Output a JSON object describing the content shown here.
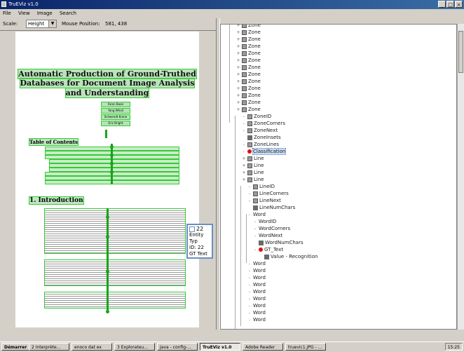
{
  "window": {
    "title": "TruEViz v1.0",
    "controls": [
      "_",
      "□",
      "×"
    ]
  },
  "menu": [
    "File",
    "View",
    "Image",
    "Search"
  ],
  "toolbar": {
    "scale_label": "Scale:",
    "scale_value": "Height",
    "mouse_label": "Mouse Position:",
    "mouse_value": "581, 438"
  },
  "document": {
    "title_lines": [
      "Automatic Production of Ground-Truthed",
      "Databases for Document Image Analysis",
      "and Understanding"
    ],
    "authors": [
      "Faron Bassi",
      "Yang Wholl",
      "Schwendt Krone",
      "Eric Bright"
    ],
    "toc_heading": "Table of Contents",
    "section_heading": "1. Introduction"
  },
  "tooltip": {
    "number": "22",
    "lines": [
      "Entity Typ",
      "ID: 22",
      "GT Text"
    ]
  },
  "tree": [
    {
      "label": "Zone",
      "icon": "doc",
      "depth": 0,
      "handle": "+"
    },
    {
      "label": "Zone",
      "icon": "doc",
      "depth": 0,
      "handle": "+"
    },
    {
      "label": "Zone",
      "icon": "doc",
      "depth": 0,
      "handle": "+"
    },
    {
      "label": "Zone",
      "icon": "doc",
      "depth": 0,
      "handle": "+"
    },
    {
      "label": "Zone",
      "icon": "doc",
      "depth": 0,
      "handle": "+"
    },
    {
      "label": "Zone",
      "icon": "doc",
      "depth": 0,
      "handle": "+"
    },
    {
      "label": "Zone",
      "icon": "doc",
      "depth": 0,
      "handle": "+"
    },
    {
      "label": "Zone",
      "icon": "doc",
      "depth": 0,
      "handle": "+"
    },
    {
      "label": "Zone",
      "icon": "doc",
      "depth": 0,
      "handle": "+"
    },
    {
      "label": "Zone",
      "icon": "doc",
      "depth": 0,
      "handle": "+"
    },
    {
      "label": "Zone",
      "icon": "doc",
      "depth": 0,
      "handle": "+"
    },
    {
      "label": "Zone",
      "icon": "doc",
      "depth": 0,
      "handle": "+"
    },
    {
      "label": "Zone",
      "icon": "doc",
      "depth": 0,
      "handle": "+"
    },
    {
      "label": "ZoneID",
      "icon": "doc",
      "depth": 1,
      "handle": "-"
    },
    {
      "label": "ZoneCorners",
      "icon": "doc",
      "depth": 1,
      "handle": "-"
    },
    {
      "label": "ZoneNext",
      "icon": "doc",
      "depth": 1,
      "handle": "-"
    },
    {
      "label": "ZoneInsets",
      "icon": "leaf",
      "depth": 1,
      "handle": ""
    },
    {
      "label": "ZoneLines",
      "icon": "doc",
      "depth": 1,
      "handle": "-"
    },
    {
      "label": "Classification",
      "icon": "err",
      "depth": 1,
      "handle": "-",
      "selected": true
    },
    {
      "label": "Line",
      "icon": "doc",
      "depth": 1,
      "handle": "+"
    },
    {
      "label": "Line",
      "icon": "doc",
      "depth": 1,
      "handle": "+"
    },
    {
      "label": "Line",
      "icon": "doc",
      "depth": 1,
      "handle": "+"
    },
    {
      "label": "Line",
      "icon": "doc",
      "depth": 1,
      "handle": "+"
    },
    {
      "label": "LineID",
      "icon": "doc",
      "depth": 2,
      "handle": "-"
    },
    {
      "label": "LineCorners",
      "icon": "doc",
      "depth": 2,
      "handle": "-"
    },
    {
      "label": "LineNext",
      "icon": "doc",
      "depth": 2,
      "handle": "-"
    },
    {
      "label": "LineNumChars",
      "icon": "leaf",
      "depth": 2,
      "handle": ""
    },
    {
      "label": "Word",
      "icon": "none",
      "depth": 2,
      "handle": "-"
    },
    {
      "label": "WordID",
      "icon": "none",
      "depth": 3,
      "handle": "-"
    },
    {
      "label": "WordCorners",
      "icon": "none",
      "depth": 3,
      "handle": "-"
    },
    {
      "label": "WordNext",
      "icon": "none",
      "depth": 3,
      "handle": "-"
    },
    {
      "label": "WordNumChars",
      "icon": "leaf",
      "depth": 3,
      "handle": ""
    },
    {
      "label": "GT_Text",
      "icon": "err",
      "depth": 3,
      "handle": "-"
    },
    {
      "label": "Value - Recognition",
      "icon": "leaf",
      "depth": 4,
      "handle": ""
    },
    {
      "label": "Word",
      "icon": "none",
      "depth": 2,
      "handle": "-"
    },
    {
      "label": "Word",
      "icon": "none",
      "depth": 2,
      "handle": "-"
    },
    {
      "label": "Word",
      "icon": "none",
      "depth": 2,
      "handle": "-"
    },
    {
      "label": "Word",
      "icon": "none",
      "depth": 2,
      "handle": "-"
    },
    {
      "label": "Word",
      "icon": "none",
      "depth": 2,
      "handle": "-"
    },
    {
      "label": "Word",
      "icon": "none",
      "depth": 2,
      "handle": "-"
    },
    {
      "label": "Word",
      "icon": "none",
      "depth": 2,
      "handle": "-"
    },
    {
      "label": "Word",
      "icon": "none",
      "depth": 2,
      "handle": "-"
    },
    {
      "label": "Word",
      "icon": "none",
      "depth": 2,
      "handle": "-"
    }
  ],
  "taskbar": {
    "start": "Démarrer",
    "tasks": [
      {
        "label": "2 Interprète...",
        "active": false
      },
      {
        "label": "enoco dat ex",
        "active": false
      },
      {
        "label": "3 Explorateu...",
        "active": false
      },
      {
        "label": "Java - config-...",
        "active": false
      },
      {
        "label": "TruEViz v1.0",
        "active": true
      },
      {
        "label": "Adobe Reader",
        "active": false
      },
      {
        "label": "truevic1.JPG - ...",
        "active": false
      }
    ],
    "clock": "15:25"
  }
}
